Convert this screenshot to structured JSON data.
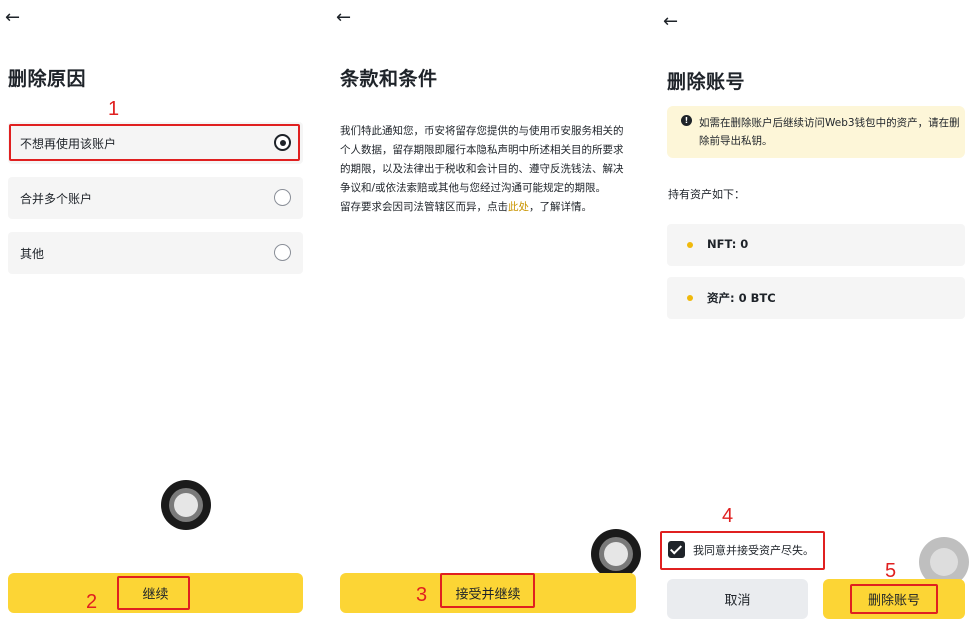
{
  "screen1": {
    "back_icon": "←",
    "title": "删除原因",
    "options": [
      {
        "label": "不想再使用该账户",
        "selected": true
      },
      {
        "label": "合并多个账户",
        "selected": false
      },
      {
        "label": "其他",
        "selected": false
      }
    ],
    "continue_label": "继续",
    "step_markers": [
      "1",
      "2"
    ]
  },
  "screen2": {
    "back_icon": "←",
    "title": "条款和条件",
    "paragraph": "我们特此通知您，币安将留存您提供的与使用币安服务相关的个人数据，留存期限即履行本隐私声明中所述相关目的所要求的期限，以及法律出于税收和会计目的、遵守反洗钱法、解决争议和/或依法索赔或其他与您经过沟通可能规定的期限。",
    "retention_prefix": "留存要求会因司法管辖区而异，点击",
    "retention_link": "此处",
    "retention_suffix": "，了解详情。",
    "accept_label": "接受并继续",
    "step_marker": "3"
  },
  "screen3": {
    "back_icon": "←",
    "title": "删除账号",
    "notice_icon": "!",
    "notice": "如需在删除账户后继续访问Web3钱包中的资产，请在删除前导出私钥。",
    "assets_heading": "持有资产如下：",
    "assets": [
      {
        "label": "NFT: 0"
      },
      {
        "label": "资产: 0 BTC"
      }
    ],
    "agree_label": "我同意并接受资产尽失。",
    "agree_checked": true,
    "cancel_label": "取消",
    "delete_label": "删除账号",
    "step_markers": [
      "4",
      "5"
    ]
  },
  "colors": {
    "primary": "#fcd535",
    "annotation": "#e02020",
    "link": "#c99400",
    "notice_bg": "#fdf6d8",
    "card_bg": "#f5f5f5"
  }
}
